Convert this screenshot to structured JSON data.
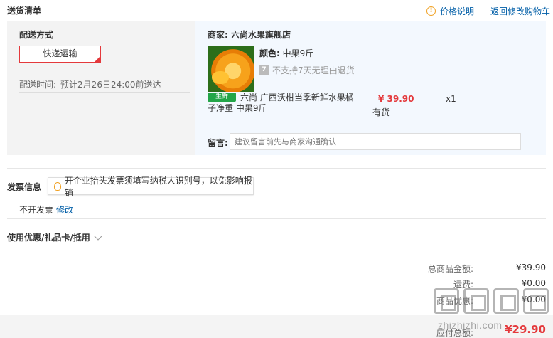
{
  "header": {
    "title": "送货清单",
    "price_note": "价格说明",
    "back_to_cart": "返回修改购物车"
  },
  "shipping": {
    "label": "配送方式",
    "method": "快递运输",
    "time_label": "配送时间:",
    "time_value": "预计2月26日24:00前送达"
  },
  "merchant": {
    "label": "商家:",
    "name": "六尚水果旗舰店"
  },
  "product": {
    "color_label": "颜色:",
    "color_value": "中果9斤",
    "no_return_icon": "7",
    "no_return_text": "不支持7天无理由退货",
    "fresh_badge": "生鲜",
    "name": "六尚 广西沃柑当季新鲜水果橘子净重 中果9斤",
    "price": "¥ 39.90",
    "quantity": "x1",
    "stock": "有货"
  },
  "message": {
    "label": "留言:",
    "placeholder": "建议留言前先与商家沟通确认"
  },
  "invoice": {
    "title": "发票信息",
    "tip": "开企业抬头发票须填写纳税人识别号，以免影响报销",
    "state": "不开发票",
    "edit": "修改"
  },
  "coupon": {
    "label": "使用优惠/礼品卡/抵用"
  },
  "summary": {
    "rows": [
      {
        "label": "总商品金额:",
        "value": "¥39.90"
      },
      {
        "label": "运费:",
        "value": "¥0.00"
      },
      {
        "label": "商品优惠:",
        "value": "-¥0.00"
      }
    ],
    "payable_label": "应付总额:",
    "payable_value": "¥29.90"
  },
  "watermark": {
    "text": "zhizhizhi.com"
  },
  "colors": {
    "accent_red": "#e4393c",
    "link_blue": "#005ea7",
    "fresh_green": "#23a548",
    "warn_orange": "#f0a020"
  },
  "icons": [
    "warning-icon",
    "return-policy-icon",
    "fresh-badge",
    "bulb-icon",
    "chevron-down-icon"
  ]
}
